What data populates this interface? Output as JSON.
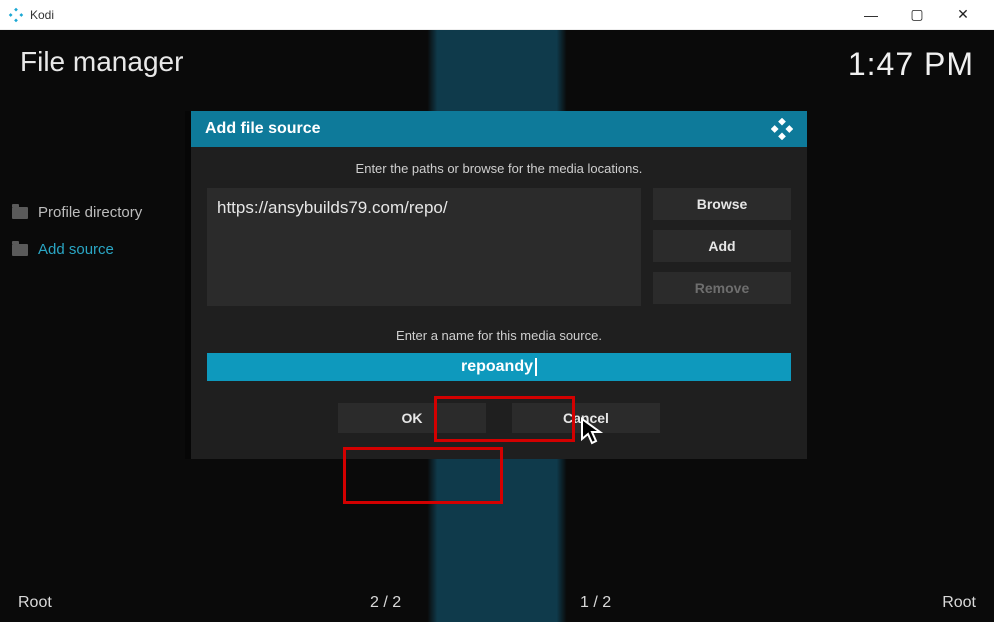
{
  "window": {
    "app_title": "Kodi",
    "minimize_glyph": "—",
    "maximize_glyph": "▢",
    "close_glyph": "✕"
  },
  "header": {
    "page_title": "File manager",
    "clock": "1:47 PM"
  },
  "left_list": {
    "profile_dir": "Profile directory",
    "add_source": "Add source"
  },
  "footer": {
    "left_label": "Root",
    "pager_left": "2 / 2",
    "pager_right": "1 / 2",
    "right_label": "Root"
  },
  "dialog": {
    "title": "Add file source",
    "instr_paths": "Enter the paths or browse for the media locations.",
    "path_value": "https://ansybuilds79.com/repo/",
    "browse": "Browse",
    "add": "Add",
    "remove": "Remove",
    "instr_name": "Enter a name for this media source.",
    "name_value": "repoandy",
    "ok": "OK",
    "cancel": "Cancel"
  }
}
